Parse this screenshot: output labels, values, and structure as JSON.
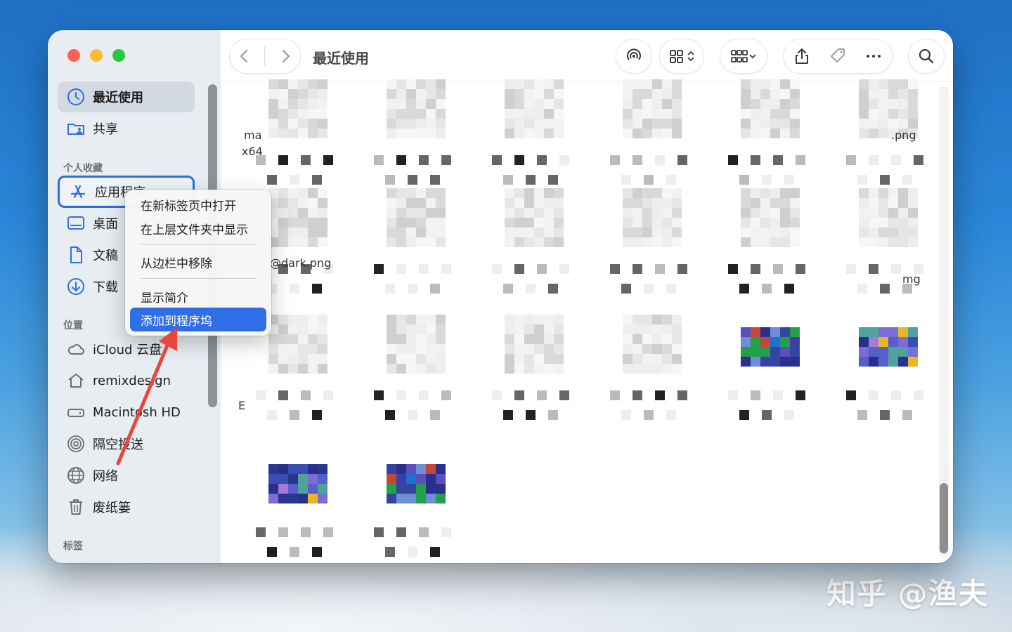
{
  "window": {
    "title": "最近使用"
  },
  "sidebar": {
    "items": [
      {
        "label": "最近使用",
        "icon": "clock-icon"
      },
      {
        "label": "共享",
        "icon": "shared-folder-icon"
      },
      {
        "label": "应用程序",
        "icon": "applications-icon"
      },
      {
        "label": "桌面",
        "icon": "desktop-icon"
      },
      {
        "label": "文稿",
        "icon": "document-icon"
      },
      {
        "label": "下载",
        "icon": "download-icon"
      },
      {
        "label": "iCloud 云盘",
        "icon": "cloud-icon"
      },
      {
        "label": "remixdesign",
        "icon": "home-icon"
      },
      {
        "label": "Macintosh HD",
        "icon": "disk-icon"
      },
      {
        "label": "隔空投送",
        "icon": "airdrop-icon"
      },
      {
        "label": "网络",
        "icon": "globe-icon"
      },
      {
        "label": "废纸篓",
        "icon": "trash-icon"
      }
    ],
    "sections": {
      "favorites": "个人收藏",
      "locations": "位置",
      "tags": "标签"
    }
  },
  "context_menu": {
    "items": [
      "在新标签页中打开",
      "在上层文件夹中显示",
      "从边栏中移除",
      "显示简介",
      "添加到程序坞"
    ],
    "active_item": "添加到程序坞"
  },
  "files": {
    "visible_fragments": [
      "ma",
      "x64",
      ".png",
      "@dark.png",
      "mg",
      "E"
    ]
  },
  "watermark": "知乎 @渔夫",
  "colors": {
    "accent": "#2f6ee6",
    "annotation_arrow": "#e8453c",
    "sidebar_bg": "#e8edf2"
  }
}
